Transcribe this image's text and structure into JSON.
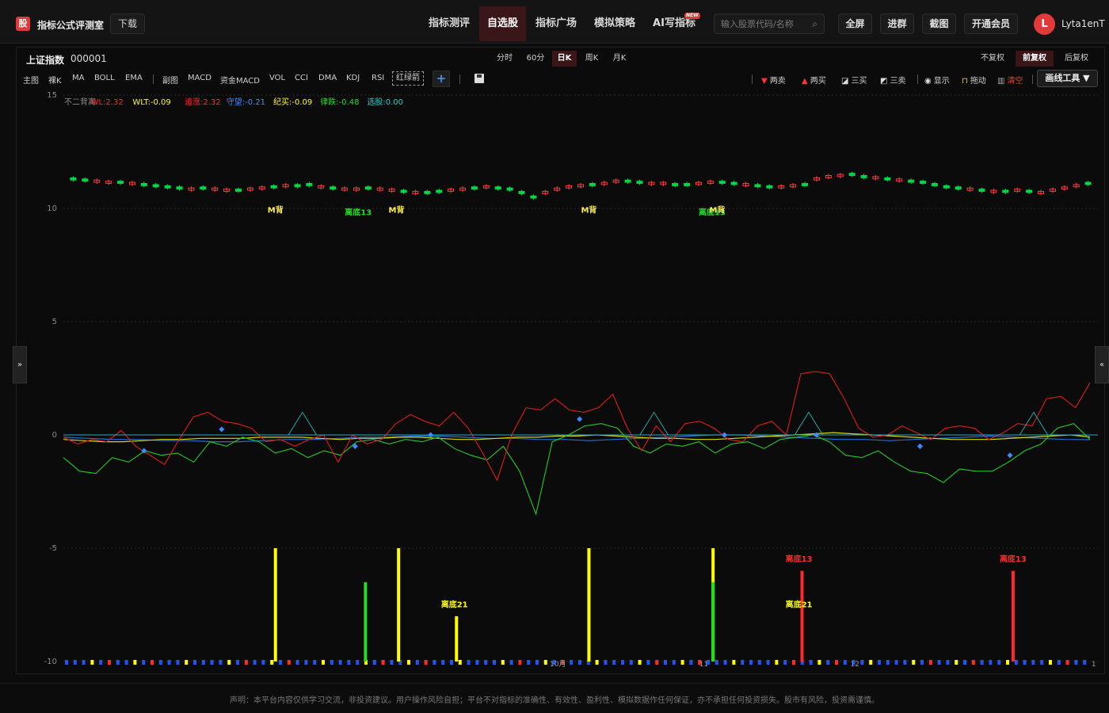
{
  "header": {
    "logo_char": "股",
    "brand": "指标公式评测室",
    "download": "下载",
    "nav": [
      "指标测评",
      "自选股",
      "指标广场",
      "模拟策略",
      "AI写指标"
    ],
    "active_nav": "自选股",
    "new_badge": "NEW",
    "search_placeholder": "输入股票代码/名称",
    "buttons": [
      "全屏",
      "进群",
      "截图",
      "开通会员"
    ],
    "avatar_letter": "L",
    "username": "Lyta1enT"
  },
  "stock": {
    "name": "上证指数",
    "code": "000001"
  },
  "periods": [
    "分时",
    "60分",
    "日K",
    "周K",
    "月K"
  ],
  "active_period": "日K",
  "adjust": [
    "不复权",
    "前复权",
    "后复权"
  ],
  "active_adjust": "前复权",
  "indicators_main": [
    "主图",
    "裸K",
    "MA",
    "BOLL",
    "EMA"
  ],
  "indicators_sub": [
    "副图",
    "MACD",
    "资金MACD",
    "VOL",
    "CCI",
    "DMA",
    "KDJ",
    "RSI"
  ],
  "active_indicator": "红绿箭",
  "tools": [
    {
      "icon": "▼",
      "label": "两卖",
      "color": "#ff3333"
    },
    {
      "icon": "▲",
      "label": "两买",
      "color": "#ff3333"
    },
    {
      "icon": "◪",
      "label": "三买",
      "color": "#dddddd"
    },
    {
      "icon": "◩",
      "label": "三卖",
      "color": "#dddddd"
    },
    {
      "icon": "👁",
      "label": "显示",
      "color": "#dddddd"
    },
    {
      "icon": "🔒",
      "label": "拖动",
      "color": "#dddddd"
    },
    {
      "icon": "🗑",
      "label": "清空",
      "color": "#ff3333"
    }
  ],
  "draw_tools": "画线工具 ▼",
  "legend": [
    {
      "text": "不二背离",
      "color": "#8a8a8a"
    },
    {
      "text": "WL:2.32",
      "color": "#ff2a2a"
    },
    {
      "text": "WLT:-0.09",
      "color": "#ffff00"
    },
    {
      "text": "追涨:2.32",
      "color": "#ff2a2a"
    },
    {
      "text": "守望:-0.21",
      "color": "#3b8cff"
    },
    {
      "text": "纪买:-0.09",
      "color": "#ffff00"
    },
    {
      "text": "律跌:-0.48",
      "color": "#22dd22"
    },
    {
      "text": "选股:0.00",
      "color": "#22cccc"
    }
  ],
  "chart_data": {
    "type": "line",
    "y_ticks": [
      15,
      10,
      5,
      0,
      -5,
      -10
    ],
    "ylim": [
      -10,
      15
    ],
    "grid": true,
    "price_series": [
      11.3,
      11.25,
      11.2,
      11.15,
      11.15,
      11.1,
      11.05,
      11.0,
      10.95,
      10.9,
      10.85,
      10.9,
      10.85,
      10.8,
      10.8,
      10.85,
      10.9,
      10.95,
      11.0,
      11.0,
      11.05,
      10.95,
      10.9,
      10.85,
      10.85,
      10.9,
      10.85,
      10.8,
      10.75,
      10.7,
      10.7,
      10.75,
      10.8,
      10.85,
      10.9,
      10.95,
      10.9,
      10.85,
      10.7,
      10.5,
      10.7,
      10.85,
      10.95,
      11.0,
      11.05,
      11.1,
      11.2,
      11.2,
      11.15,
      11.1,
      11.1,
      11.05,
      11.05,
      11.1,
      11.15,
      11.15,
      11.1,
      11.05,
      11.0,
      10.95,
      10.95,
      11.0,
      11.05,
      11.3,
      11.4,
      11.45,
      11.5,
      11.4,
      11.35,
      11.3,
      11.25,
      11.2,
      11.15,
      11.05,
      10.95,
      10.9,
      10.85,
      10.8,
      10.75,
      10.75,
      10.8,
      10.75,
      10.7,
      10.8,
      10.9,
      11.0,
      11.1
    ],
    "price_up": [
      0,
      0,
      1,
      1,
      0,
      1,
      0,
      0,
      0,
      0,
      1,
      0,
      1,
      1,
      0,
      1,
      1,
      0,
      1,
      0,
      0,
      1,
      0,
      1,
      1,
      0,
      1,
      1,
      0,
      1,
      0,
      0,
      1,
      1,
      0,
      1,
      0,
      0,
      0,
      0,
      1,
      1,
      1,
      1,
      0,
      1,
      1,
      0,
      0,
      1,
      1,
      0,
      0,
      1,
      1,
      0,
      0,
      1,
      0,
      0,
      1,
      1,
      0,
      1,
      1,
      1,
      0,
      0,
      1,
      0,
      1,
      0,
      0,
      0,
      0,
      0,
      1,
      0,
      1,
      0,
      1,
      0,
      1,
      1,
      1,
      1
    ],
    "red_line": [
      -0.1,
      -0.4,
      -0.2,
      -0.3,
      0.2,
      -0.5,
      -0.9,
      -1.3,
      -0.2,
      0.8,
      1.0,
      0.6,
      0.5,
      0.3,
      -0.3,
      -0.2,
      -0.5,
      -0.2,
      0.0,
      -1.2,
      0.0,
      -0.4,
      -0.2,
      0.5,
      0.9,
      0.6,
      0.4,
      1.0,
      0.3,
      -0.8,
      -2.0,
      0.0,
      1.2,
      1.1,
      1.6,
      1.1,
      1.0,
      1.2,
      1.8,
      0.3,
      -0.7,
      0.4,
      -0.3,
      0.5,
      0.6,
      0.3,
      -0.2,
      -0.3,
      0.4,
      0.6,
      0.0,
      2.7,
      2.8,
      2.7,
      1.6,
      0.3,
      -0.1,
      0.0,
      0.4,
      0.1,
      -0.2,
      0.3,
      0.4,
      0.3,
      -0.2,
      0.1,
      0.5,
      0.4,
      1.6,
      1.7,
      1.2,
      2.3
    ],
    "green_line": [
      -1.0,
      -1.6,
      -1.7,
      -1.0,
      -1.2,
      -0.7,
      -0.9,
      -0.8,
      -1.2,
      -0.3,
      -0.5,
      -0.1,
      -0.3,
      -0.8,
      -0.6,
      -1.0,
      -0.7,
      -0.9,
      -0.3,
      -0.2,
      -0.4,
      -0.2,
      -0.3,
      -0.1,
      -0.6,
      -0.9,
      -1.1,
      -0.5,
      -1.6,
      -3.5,
      -0.3,
      0.0,
      0.4,
      0.5,
      0.3,
      -0.5,
      -0.8,
      -0.4,
      -0.5,
      -0.3,
      -0.8,
      -0.4,
      -0.3,
      -0.6,
      -0.2,
      -0.1,
      0.0,
      -0.3,
      -0.9,
      -1.0,
      -0.7,
      -1.2,
      -1.6,
      -1.7,
      -2.1,
      -1.5,
      -1.6,
      -1.6,
      -1.2,
      -0.7,
      -0.4,
      0.3,
      0.5,
      -0.2
    ],
    "teal_line": [
      0,
      0,
      0,
      0,
      0,
      0,
      0,
      0,
      0,
      0,
      0,
      0,
      0,
      0,
      0,
      0,
      0,
      1,
      0,
      0,
      0,
      0,
      0,
      0,
      0,
      0,
      0,
      0,
      0,
      0,
      0,
      0,
      0,
      0,
      0,
      0,
      0,
      0,
      0,
      0,
      0,
      0,
      1,
      0,
      0,
      0,
      0,
      0,
      0,
      0,
      0,
      0,
      0,
      1,
      0,
      0,
      0,
      0,
      0,
      0,
      0,
      0,
      0,
      0,
      0,
      0,
      0,
      0,
      0,
      1,
      0,
      0,
      0,
      0
    ],
    "yellow_line": [
      -0.2,
      -0.25,
      -0.3,
      -0.3,
      -0.25,
      -0.2,
      -0.2,
      -0.15,
      -0.15,
      -0.15,
      -0.1,
      -0.1,
      -0.1,
      -0.15,
      -0.2,
      -0.15,
      -0.15,
      -0.1,
      -0.1,
      -0.15,
      -0.2,
      -0.2,
      -0.15,
      -0.1,
      -0.1,
      -0.05,
      -0.05,
      0.0,
      -0.05,
      -0.1,
      -0.15,
      -0.15,
      -0.2,
      -0.2,
      -0.15,
      -0.1,
      -0.05,
      0.0,
      0.05,
      0.1,
      0.05,
      0.0,
      -0.05,
      -0.1,
      -0.15,
      -0.2,
      -0.2,
      -0.2,
      -0.15,
      -0.1,
      -0.05,
      0.0,
      -0.09
    ],
    "blue_line": [
      -0.1,
      -0.15,
      -0.2,
      -0.2,
      -0.25,
      -0.25,
      -0.3,
      -0.3,
      -0.25,
      -0.2,
      -0.2,
      -0.15,
      -0.1,
      -0.1,
      -0.05,
      -0.05,
      -0.1,
      -0.15,
      -0.15,
      -0.2,
      -0.2,
      -0.25,
      -0.2,
      -0.15,
      -0.1,
      -0.05,
      0.0,
      0.0,
      -0.05,
      -0.1,
      -0.15,
      -0.2,
      -0.2,
      -0.25,
      -0.2,
      -0.15,
      -0.1,
      -0.05,
      -0.1,
      -0.15,
      -0.2,
      -0.21
    ],
    "annotations": [
      {
        "text": "M背",
        "x": 0.205,
        "y": 9.8,
        "color": "#ffee55"
      },
      {
        "text": "离底13",
        "x": 0.285,
        "y": 9.7,
        "color": "#22dd22"
      },
      {
        "text": "M背",
        "x": 0.322,
        "y": 9.8,
        "color": "#ffee55"
      },
      {
        "text": "M背",
        "x": 0.508,
        "y": 9.8,
        "color": "#ffee55"
      },
      {
        "text": "离底13",
        "x": 0.627,
        "y": 9.7,
        "color": "#22dd22"
      },
      {
        "text": "M背",
        "x": 0.632,
        "y": 9.8,
        "color": "#ffee55"
      },
      {
        "text": "离底21",
        "x": 0.378,
        "y": -7.6,
        "color": "#ffff00"
      },
      {
        "text": "离底21",
        "x": 0.711,
        "y": -7.6,
        "color": "#ffff00"
      },
      {
        "text": "离底13",
        "x": 0.711,
        "y": -5.6,
        "color": "#ff2a2a"
      },
      {
        "text": "离底13",
        "x": 0.918,
        "y": -5.6,
        "color": "#ff2a2a"
      }
    ],
    "bars": [
      {
        "x": 0.205,
        "top": -5,
        "color": "#ffff00"
      },
      {
        "x": 0.292,
        "top": -6.5,
        "color": "#22dd22"
      },
      {
        "x": 0.324,
        "top": -5,
        "color": "#ffff00"
      },
      {
        "x": 0.38,
        "top": -8,
        "color": "#ffff00"
      },
      {
        "x": 0.508,
        "top": -5,
        "color": "#ffff00"
      },
      {
        "x": 0.628,
        "top": -5,
        "color": "#ffff00"
      },
      {
        "x": 0.628,
        "top": -6.5,
        "color": "#22dd22"
      },
      {
        "x": 0.714,
        "top": -6,
        "color": "#ff2a2a"
      },
      {
        "x": 0.918,
        "top": -6,
        "color": "#ff2a2a"
      }
    ],
    "markers": [
      {
        "x": 0.078,
        "y": -0.7,
        "color": "#3b8cff"
      },
      {
        "x": 0.153,
        "y": 0.25,
        "color": "#3b8cff"
      },
      {
        "x": 0.282,
        "y": -0.5,
        "color": "#3b8cff"
      },
      {
        "x": 0.355,
        "y": 0.0,
        "color": "#3b8cff"
      },
      {
        "x": 0.499,
        "y": 0.7,
        "color": "#3b8cff"
      },
      {
        "x": 0.639,
        "y": 0.0,
        "color": "#3b8cff"
      },
      {
        "x": 0.728,
        "y": 0.0,
        "color": "#3b8cff"
      },
      {
        "x": 0.828,
        "y": -0.5,
        "color": "#3b8cff"
      },
      {
        "x": 0.915,
        "y": -0.9,
        "color": "#3b8cff"
      }
    ]
  },
  "x_labels": [
    {
      "text": "10月",
      "x": 0.478
    },
    {
      "text": "11",
      "x": 0.619
    },
    {
      "text": "12",
      "x": 0.765
    },
    {
      "text": "1",
      "x": 0.996
    }
  ],
  "disclaimer": "声明：本平台内容仅供学习交流，非投资建议。用户操作风险自担；平台不对指标的准确性、有效性、盈利性、模拟数据作任何保证，亦不承担任何投资损失。股市有风险，投资需谨慎。",
  "side_left": "»",
  "side_right": "«"
}
